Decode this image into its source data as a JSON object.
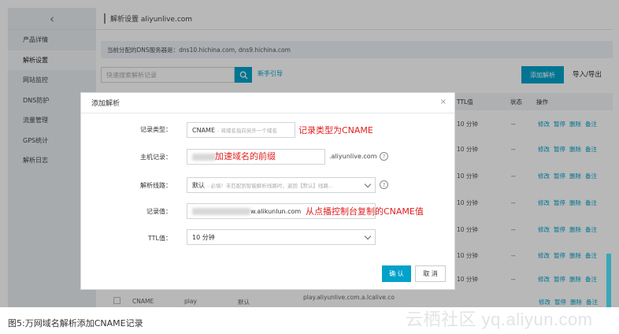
{
  "sidebar": {
    "back_icon": "chevron-left-icon",
    "items": [
      {
        "label": "产品详情"
      },
      {
        "label": "解析设置"
      },
      {
        "label": "网站监控"
      },
      {
        "label": "DNS防护"
      },
      {
        "label": "流量管理"
      },
      {
        "label": "GPS统计"
      },
      {
        "label": "解析日志"
      }
    ]
  },
  "topbar": {
    "title": "解析设置 aliyunlive.com"
  },
  "dns_info": "当前分配的DNS服务器是：dns10.hichina.com, dns9.hichina.com",
  "search": {
    "placeholder": "快速搜索解析记录"
  },
  "guide_link": "新手引导",
  "add_button": "添加解析",
  "import_export": "导入/导出",
  "table": {
    "headers": {
      "ttl": "TTL值",
      "status": "状态",
      "ops": "操作"
    },
    "rows": [
      {
        "ttl": "10 分钟",
        "status": "--"
      },
      {
        "ttl": "10 分钟",
        "status": "--"
      },
      {
        "ttl": "10 分钟",
        "status": "--"
      },
      {
        "ttl": "10 分钟",
        "status": "--"
      },
      {
        "ttl": "10 分钟",
        "status": "--"
      },
      {
        "ttl": "10 分钟",
        "status": "--"
      },
      {
        "ttl": "10 分钟",
        "status": "--"
      },
      {
        "ttl": "10 分钟",
        "status": "--"
      }
    ],
    "row_ops": [
      "修改",
      "暂停",
      "删除",
      "备注"
    ],
    "last_row": {
      "type": "CNAME",
      "host": "play",
      "line": "默认",
      "value": "play.aliyunlive.com.a.lcalive.co",
      "ops": [
        "修改",
        "暂停",
        "删除",
        "备注"
      ]
    }
  },
  "dialog": {
    "title": "添加解析",
    "close": "×",
    "record_type": {
      "label": "记录类型：",
      "value": "CNAME",
      "hint": "- 将域名指向另外一个域名",
      "annotation": "记录类型为CNAME"
    },
    "host": {
      "label": "主机记录：",
      "annotation": "加速域名的前缀",
      "suffix": ".aliyunlive.com"
    },
    "line": {
      "label": "解析线路：",
      "value": "默认",
      "hint": "- 必填！未匹配到智能解析线路时，返回【默认】线路..."
    },
    "record_value": {
      "label": "记录值：",
      "value": "w.alikunlun.com",
      "annotation": "从点播控制台复制的CNAME值"
    },
    "ttl": {
      "label": "TTL值：",
      "value": "10 分钟"
    },
    "ok": "确 认",
    "cancel": "取 消"
  },
  "caption": "图5:万网域名解析添加CNAME记录",
  "watermark": "云栖社区 yq.aliyun.com"
}
